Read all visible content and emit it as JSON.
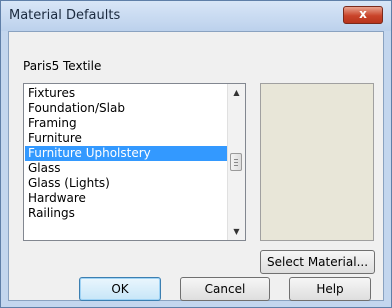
{
  "window": {
    "title": "Material Defaults",
    "close_label": "x"
  },
  "material_name": "Paris5 Textile",
  "list": {
    "items": [
      {
        "label": "Fixtures"
      },
      {
        "label": "Foundation/Slab"
      },
      {
        "label": "Framing"
      },
      {
        "label": "Furniture"
      },
      {
        "label": "Furniture Upholstery",
        "selected": true
      },
      {
        "label": "Glass"
      },
      {
        "label": "Glass (Lights)"
      },
      {
        "label": "Hardware"
      },
      {
        "label": "Railings"
      }
    ],
    "scroll_up_glyph": "▲",
    "scroll_down_glyph": "▼"
  },
  "swatch": {
    "color": "#e8e6d8"
  },
  "buttons": {
    "select_material": "Select Material...",
    "ok": "OK",
    "cancel": "Cancel",
    "help": "Help"
  },
  "colors": {
    "selection": "#3399ff",
    "close_button": "#c9442a"
  }
}
